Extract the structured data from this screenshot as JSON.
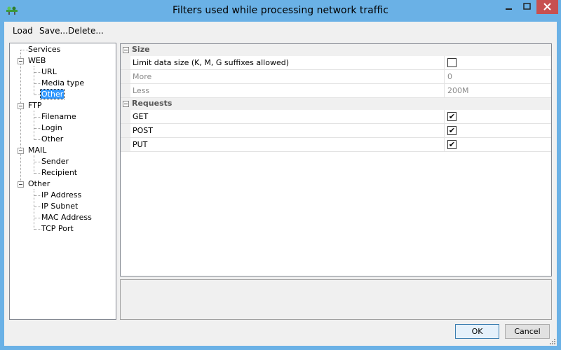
{
  "window": {
    "title": "Filters used while processing network traffic"
  },
  "menu": {
    "load": "Load",
    "save": "Save...",
    "delete": "Delete..."
  },
  "tree": [
    {
      "label": "Services"
    },
    {
      "label": "WEB"
    },
    {
      "label": "URL"
    },
    {
      "label": "Media type"
    },
    {
      "label": "Other",
      "selected": true
    },
    {
      "label": "FTP"
    },
    {
      "label": "Filename"
    },
    {
      "label": "Login"
    },
    {
      "label": "Other"
    },
    {
      "label": "MAIL"
    },
    {
      "label": "Sender"
    },
    {
      "label": "Recipient"
    },
    {
      "label": "Other"
    },
    {
      "label": "IP Address"
    },
    {
      "label": "IP Subnet"
    },
    {
      "label": "MAC Address"
    },
    {
      "label": "TCP Port"
    }
  ],
  "grid": {
    "size": {
      "label": "Size",
      "limit": {
        "name": "Limit data size (K, M, G suffixes allowed)",
        "checked": false
      },
      "more": {
        "name": "More",
        "value": "0"
      },
      "less": {
        "name": "Less",
        "value": "200M"
      }
    },
    "requests": {
      "label": "Requests",
      "get": {
        "name": "GET",
        "checked": true
      },
      "post": {
        "name": "POST",
        "checked": true
      },
      "put": {
        "name": "PUT",
        "checked": true
      }
    }
  },
  "buttons": {
    "ok": "OK",
    "cancel": "Cancel"
  },
  "colors": {
    "frame": "#6ab1e6",
    "selection": "#3399ff",
    "close": "#c75050"
  }
}
